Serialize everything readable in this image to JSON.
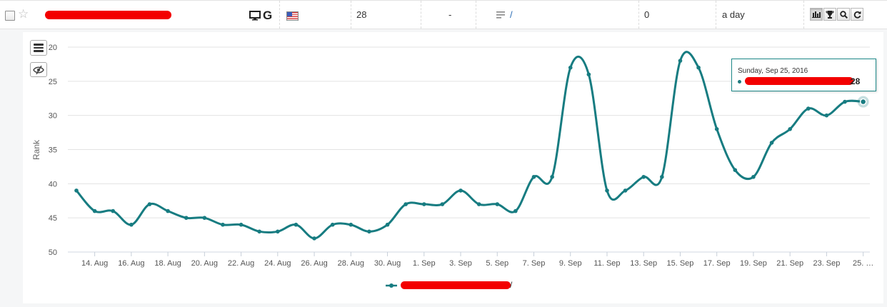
{
  "row": {
    "position": "28",
    "change": "-",
    "url_path": "/",
    "volume": "0",
    "updated": "a day",
    "toolbar_icons": [
      "chart-icon",
      "trophy-icon",
      "search-icon",
      "refresh-icon"
    ]
  },
  "chart_data": {
    "type": "line",
    "ylabel": "Rank",
    "ylim": [
      20,
      50
    ],
    "y_inverted": true,
    "yticks": [
      "20",
      "25",
      "30",
      "35",
      "40",
      "45",
      "50"
    ],
    "x_tick_labels": [
      "14. Aug",
      "16. Aug",
      "18. Aug",
      "20. Aug",
      "22. Aug",
      "24. Aug",
      "26. Aug",
      "28. Aug",
      "30. Aug",
      "1. Sep",
      "3. Sep",
      "5. Sep",
      "7. Sep",
      "9. Sep",
      "11. Sep",
      "13. Sep",
      "15. Sep",
      "17. Sep",
      "19. Sep",
      "21. Sep",
      "23. Sep",
      "25. …"
    ],
    "x_start_date": "2016-08-13",
    "series": [
      {
        "name": "/",
        "color": "#177c81",
        "values": [
          41,
          44,
          44,
          46,
          43,
          44,
          45,
          45,
          46,
          46,
          47,
          47,
          46,
          48,
          46,
          46,
          47,
          46,
          43,
          43,
          43,
          41,
          43,
          43,
          44,
          39,
          39,
          23,
          24,
          41,
          41,
          39,
          39,
          22,
          23,
          32,
          38,
          39,
          34,
          32,
          29,
          30,
          28,
          28
        ]
      }
    ],
    "grid": true,
    "legend": "bottom-center",
    "tooltip": {
      "date": "Sunday, Sep 25, 2016",
      "value": "28"
    }
  }
}
